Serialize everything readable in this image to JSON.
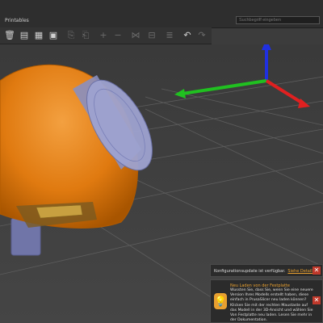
{
  "header": {
    "tab_label": "Printables"
  },
  "search": {
    "placeholder": "Suchbegriff eingeben"
  },
  "toolbar": {
    "buttons": [
      {
        "name": "delete-icon",
        "glyph": "🗑"
      },
      {
        "name": "delete-all-icon",
        "glyph": "▤"
      },
      {
        "name": "arrange-icon",
        "glyph": "▦"
      },
      {
        "name": "copy-icon",
        "glyph": "⎘"
      },
      {
        "name": "paste-icon",
        "glyph": "⎗"
      },
      {
        "name": "add-instance-icon",
        "glyph": "+"
      },
      {
        "name": "remove-instance-icon",
        "glyph": "−"
      },
      {
        "name": "split-objects-icon",
        "glyph": "⋈"
      },
      {
        "name": "split-parts-icon",
        "glyph": "⊟"
      },
      {
        "name": "layers-icon",
        "glyph": "≣"
      },
      {
        "name": "undo-icon",
        "glyph": "↶"
      },
      {
        "name": "redo-icon",
        "glyph": "↷"
      }
    ]
  },
  "notifications": {
    "config_update": {
      "message": "Konfigurationsupdate ist verfügbar.",
      "link": "Siehe Details"
    },
    "hint": {
      "title": "Neu Laden von der Festplatte",
      "body": "Wussten Sie, dass Sie, wenn Sie eine neuere Version Ihres Modells erstellt haben, diese einfach in PrusaSlicer neu laden können? Klicken Sie mit der rechten Maustaste auf das Modell in der 3D-Ansicht und wählen Sie Von Festplatte neu laden. Lesen Sie mehr in der Dokumentation."
    }
  },
  "colors": {
    "model_body": "#e07a10",
    "modifier_part": "#8a8fc0",
    "axis_x": "#e02020",
    "axis_y": "#20c020",
    "axis_z": "#2030e0",
    "accent": "#e8a030"
  }
}
